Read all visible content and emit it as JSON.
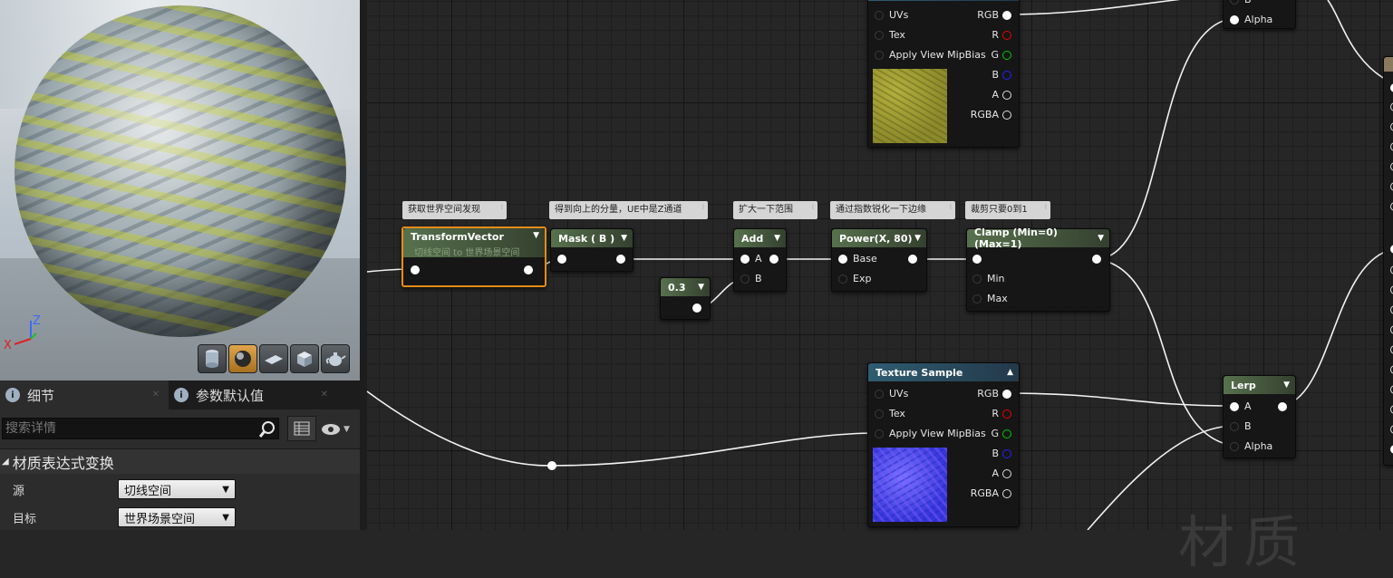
{
  "viewport": {
    "axis": {
      "z": "Z",
      "x": "X"
    },
    "toolbar": [
      {
        "icon": "cylinder-preview-icon",
        "active": false
      },
      {
        "icon": "sphere-preview-icon",
        "active": true
      },
      {
        "icon": "plane-preview-icon",
        "active": false
      },
      {
        "icon": "cube-preview-icon",
        "active": false
      },
      {
        "icon": "teapot-preview-icon",
        "active": false
      }
    ]
  },
  "details": {
    "tabs": [
      {
        "label": "细节",
        "icon": "details-icon"
      },
      {
        "label": "参数默认值",
        "icon": "parameters-icon"
      }
    ],
    "search": {
      "placeholder": "搜索详情"
    },
    "category": "材质表达式变换",
    "properties": [
      {
        "label": "源",
        "value": "切线空间"
      },
      {
        "label": "目标",
        "value": "世界场景空间"
      }
    ]
  },
  "graph": {
    "comments": {
      "c1": "获取世界空间发现",
      "c2": "得到向上的分量，UE中是Z通道",
      "c3": "扩大一下范围",
      "c4": "通过指数锐化一下边缘",
      "c5": "裁剪只要0到1"
    },
    "transform_vector": {
      "title": "TransformVector",
      "subtitle": "切线空间 to 世界场景空间"
    },
    "mask": {
      "title": "Mask ( B )"
    },
    "add": {
      "title": "Add",
      "pin_a": "A",
      "pin_b": "B"
    },
    "constant": {
      "title": "0.3"
    },
    "power": {
      "title": "Power(X, 80)",
      "pin_base": "Base",
      "pin_exp": "Exp"
    },
    "clamp": {
      "title": "Clamp (Min=0) (Max=1)",
      "pin_min": "Min",
      "pin_max": "Max"
    },
    "texture_top": {
      "inputs": [
        "UVs",
        "Tex",
        "Apply View MipBias"
      ],
      "outputs": [
        "RGB",
        "R",
        "G",
        "B",
        "A",
        "RGBA"
      ]
    },
    "texture_bottom": {
      "title": "Texture Sample",
      "inputs": [
        "UVs",
        "Tex",
        "Apply View MipBias"
      ],
      "outputs": [
        "RGB",
        "R",
        "G",
        "B",
        "A",
        "RGBA"
      ]
    },
    "lerp_top": {
      "pin_alpha": "Alpha",
      "pin_b": "B"
    },
    "lerp_bottom": {
      "title": "Lerp",
      "pin_a": "A",
      "pin_b": "B",
      "pin_alpha": "Alpha"
    },
    "watermark": "材质"
  }
}
